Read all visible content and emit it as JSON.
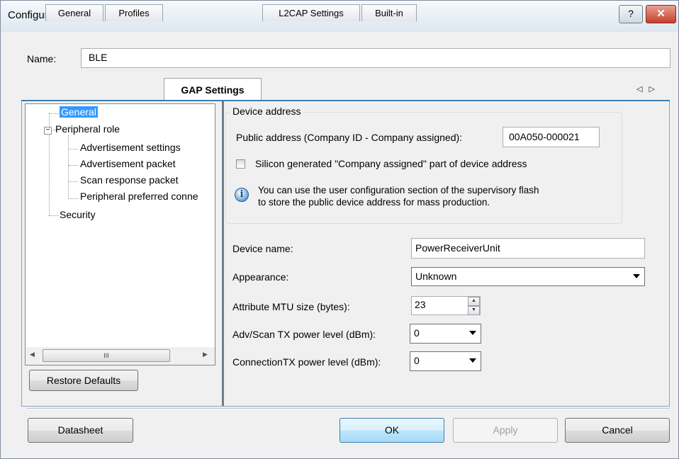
{
  "window": {
    "title": "Configure 'BLE'",
    "help_label": "?",
    "close_label": "✕"
  },
  "name_field": {
    "label": "Name:",
    "value": "BLE"
  },
  "tabs": [
    {
      "label": "General"
    },
    {
      "label": "Profiles"
    },
    {
      "label": "GAP Settings",
      "active": true
    },
    {
      "label": "L2CAP Settings"
    },
    {
      "label": "Built-in"
    }
  ],
  "tab_scroll": {
    "left": "◁",
    "right": "▷"
  },
  "tree": {
    "items": [
      {
        "label": "General",
        "selected": true
      },
      {
        "label": "Peripheral role",
        "expander": "−"
      },
      {
        "label": "Advertisement settings"
      },
      {
        "label": "Advertisement packet"
      },
      {
        "label": "Scan response packet"
      },
      {
        "label": "Peripheral preferred conne"
      },
      {
        "label": "Security"
      }
    ],
    "scroll_thumb": "III",
    "scroll_left": "◀",
    "scroll_right": "▶"
  },
  "restore_defaults": "Restore Defaults",
  "device_address": {
    "group_title": "Device address",
    "public_label": "Public address (Company ID - Company assigned):",
    "public_value": "00A050-000021",
    "silicon_label": "Silicon generated \"Company assigned\" part of device address",
    "silicon_checked": false,
    "info_glyph": "i",
    "info_line1": "You can use the user configuration section of the supervisory flash",
    "info_line2": "to store the public device address for mass production."
  },
  "settings": {
    "device_name_label": "Device name:",
    "device_name_value": "PowerReceiverUnit",
    "appearance_label": "Appearance:",
    "appearance_value": "Unknown",
    "mtu_label": "Attribute MTU size (bytes):",
    "mtu_value": "23",
    "mtu_up": "▲",
    "mtu_down": "▼",
    "adv_tx_label": "Adv/Scan TX power level (dBm):",
    "adv_tx_value": "0",
    "conn_tx_label": "ConnectionTX power level (dBm):",
    "conn_tx_value": "0"
  },
  "footer": {
    "datasheet": "Datasheet",
    "ok": "OK",
    "apply": "Apply",
    "cancel": "Cancel"
  },
  "colors": {
    "selection": "#3399ff",
    "tab_accent": "#3c7fb1",
    "close_red": "#c4402a"
  }
}
